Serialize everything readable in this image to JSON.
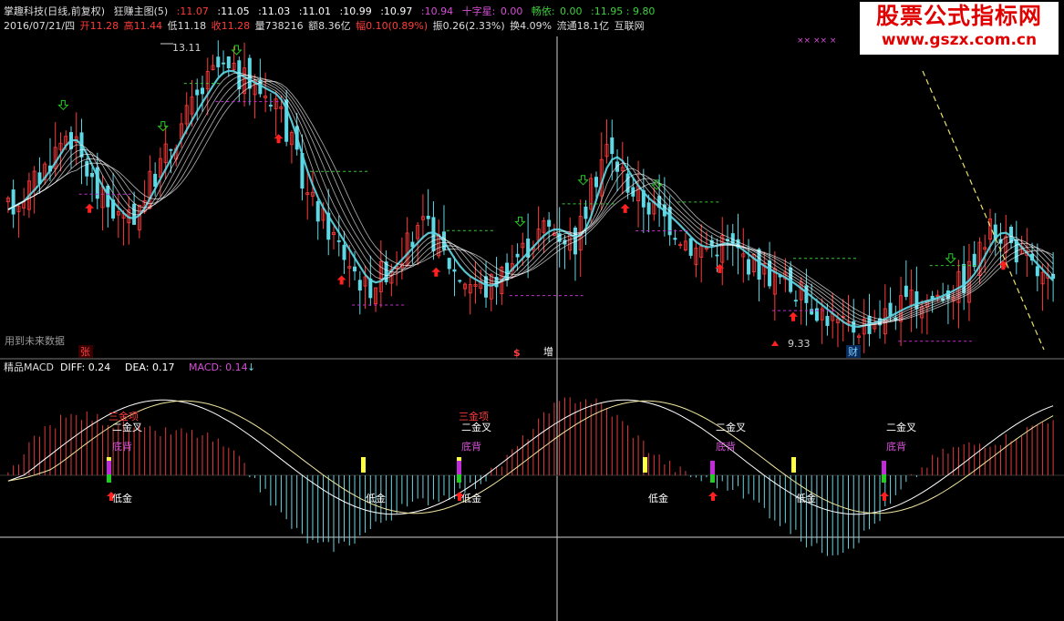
{
  "header": {
    "stock_name": "掌趣科技(日线,前复权)",
    "indicator_name": "狂赚主图(5)",
    "ma_values": [
      ":11.07",
      ":11.05",
      ":11.03",
      ":11.01",
      ":10.99",
      ":10.97",
      ":10.94"
    ],
    "doji_label": "十字星:",
    "doji_value": "0.00",
    "slot_label": "畅依:",
    "slot_value": "0.00",
    "extra_values": ":11.95 : 9.80",
    "date": "2016/07/21/四",
    "open": "开11.28",
    "high": "高11.44",
    "low": "低11.18",
    "close": "收11.28",
    "volume": "量738216",
    "amount": "额8.36亿",
    "change": "幅0.10(0.89%)",
    "amplitude": "振0.26(2.33%)",
    "turnover": "换4.09%",
    "float_cap": "流通18.1亿",
    "sector": "互联网"
  },
  "brand": {
    "title": "股票公式指标网",
    "url": "www.gszx.com.cn"
  },
  "main_panel": {
    "max_price_label": "13.11",
    "min_price_label": "9.33",
    "future_data_label": "用到未来数据",
    "markers": [
      "张",
      "$",
      "增",
      "财"
    ],
    "cross_marks": "×× ×× ×",
    "colors": {
      "up": "#ff3b3b",
      "down": "#5fd8e6",
      "fan": "#ffffff",
      "resistance": "#34c734",
      "support": "#c82cd3",
      "signal_up": "#ff2020",
      "signal_down": "#22cc22",
      "trend": "#e9e36b"
    }
  },
  "macd_panel": {
    "title": "精品MACD",
    "diff_label": "DIFF: 0.24",
    "dea_label": "DEA: 0.17",
    "macd_label": "MACD: 0.14",
    "labels": {
      "triple_gold_top": "三金项",
      "double_golden_cross": "二金叉",
      "bottom_divergence": "底背",
      "low_gold": "低金"
    }
  },
  "chart_data": {
    "type": "candlestick",
    "title": "掌趣科技(日线,前复权)",
    "series": [
      {
        "name": "DIFF",
        "last_value": 0.24
      },
      {
        "name": "DEA",
        "last_value": 0.17
      },
      {
        "name": "MACD",
        "last_value": 0.14
      }
    ],
    "price_extremes": {
      "high": 13.11,
      "low": 9.33
    },
    "price_trend": [
      11.0,
      11.4,
      12.0,
      11.2,
      10.8,
      11.5,
      12.2,
      12.8,
      12.6,
      12.4,
      11.2,
      10.6,
      10.0,
      10.4,
      10.8,
      10.2,
      10.0,
      10.4,
      10.8,
      10.6,
      11.8,
      11.2,
      10.9,
      10.5,
      10.6,
      10.3,
      10.1,
      9.8,
      9.5,
      9.6,
      9.8,
      9.9,
      10.1,
      10.8,
      10.4,
      10.0
    ]
  }
}
